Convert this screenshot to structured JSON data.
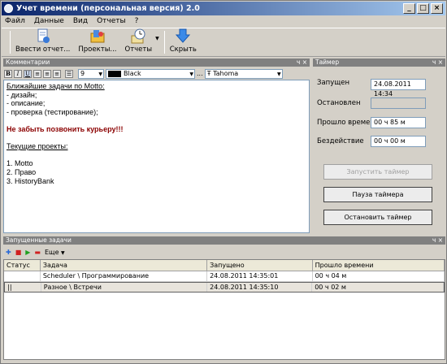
{
  "window": {
    "title": "Учет времени (персональная версия) 2.0",
    "min": "_",
    "max": "□",
    "close": "×"
  },
  "menu": [
    "Файл",
    "Данные",
    "Вид",
    "Отчеты",
    "?"
  ],
  "toolbar": {
    "enter_report": "Ввести отчет...",
    "projects": "Проекты...",
    "reports": "Отчеты",
    "hide": "Скрыть"
  },
  "comments": {
    "header": "Комментарии",
    "pin": "ч ×",
    "font_size": "9",
    "color_name": "Black",
    "font_name": "Tahoma"
  },
  "editor": {
    "line1": "Ближайшие задачи по Motto:",
    "line2": "- дизайн;",
    "line3": "- описание;",
    "line4": "- проверка (тестирование);",
    "line5": "Не забыть позвонить курьеру!!!",
    "line6": "Текущие проекты:",
    "line7": "1. Motto",
    "line8": "2. Право",
    "line9": "3. HistoryBank"
  },
  "timer": {
    "header": "Таймер",
    "pin": "ч ×",
    "started_label": "Запущен",
    "started_value": "24.08.2011 14:34",
    "stopped_label": "Остановлен",
    "stopped_value": "",
    "elapsed_label": "Прошло времени",
    "elapsed_value": "00 ч 85 м",
    "idle_label": "Бездействие",
    "idle_value": "00 ч 00 м",
    "start_btn": "Запустить таймер",
    "pause_btn": "Пауза таймера",
    "stop_btn": "Остановить таймер"
  },
  "tasks": {
    "header": "Запущенные задачи",
    "pin": "ч ×",
    "more": "Еще",
    "columns": [
      "Статус",
      "Задача",
      "Запущено",
      "Прошло времени"
    ],
    "rows": [
      {
        "status": "",
        "task": "Scheduler \\ Программирование",
        "started": "24.08.2011 14:35:01",
        "elapsed": "00 ч 04 м"
      },
      {
        "status": "||",
        "task": "Разное \\ Встречи",
        "started": "24.08.2011 14:35:10",
        "elapsed": "00 ч 02 м"
      }
    ]
  },
  "colors": {
    "title_gradient_start": "#0a246a",
    "accent_red": "#8b0000",
    "panel_head": "#808080"
  }
}
